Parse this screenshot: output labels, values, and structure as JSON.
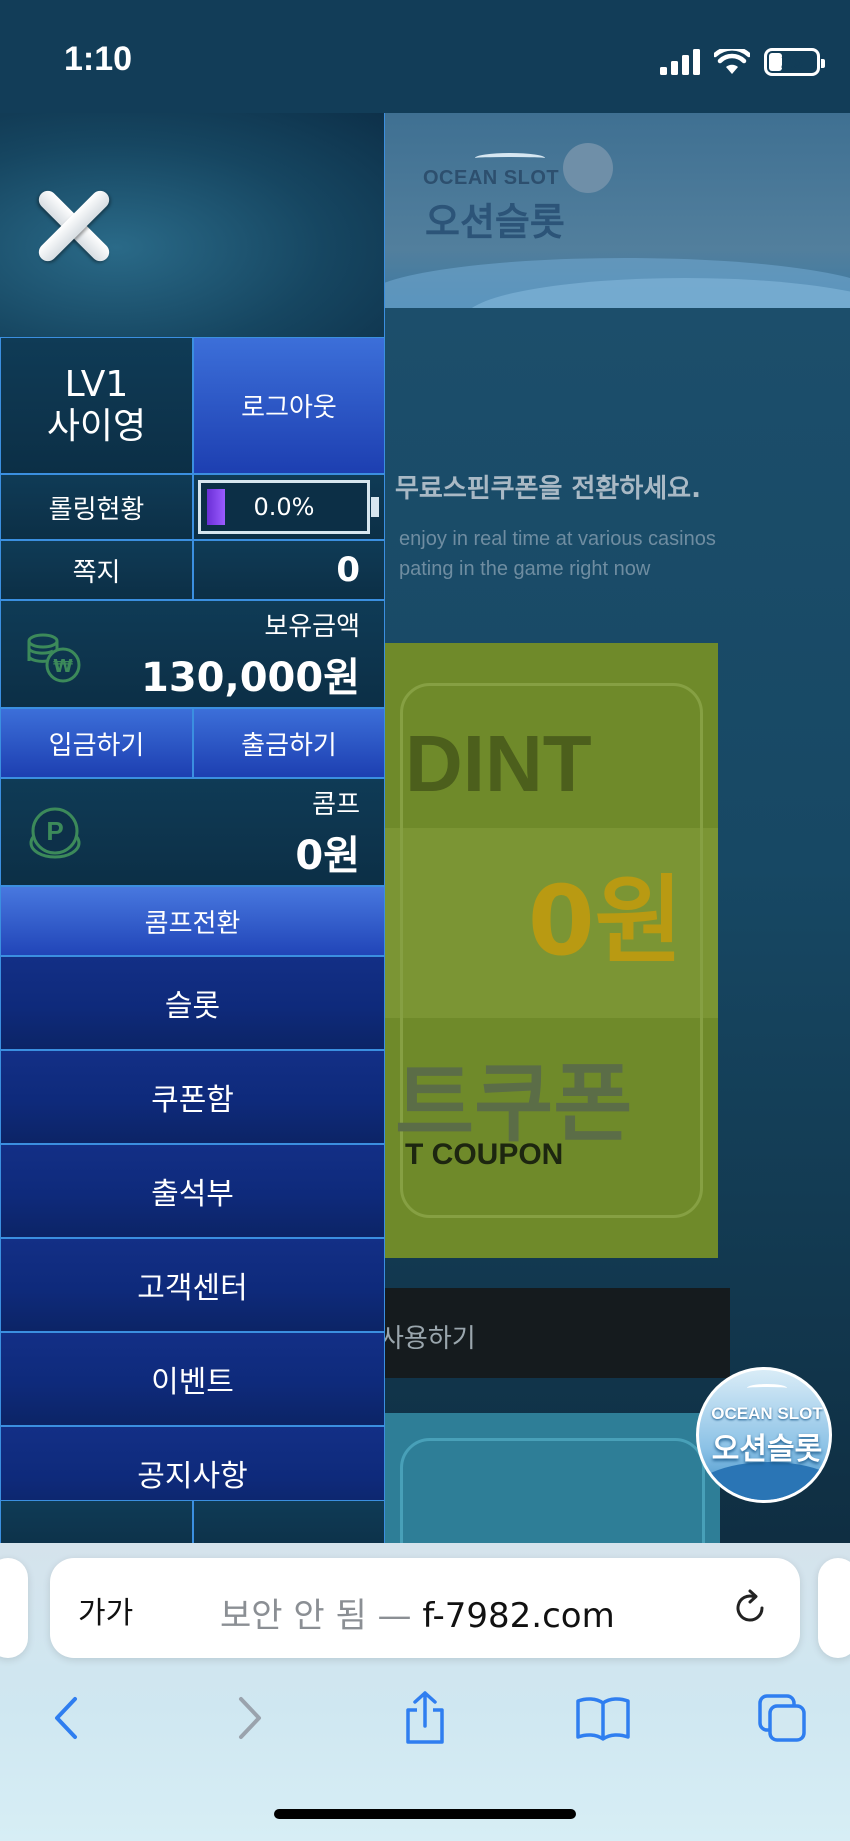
{
  "status_bar": {
    "time": "1:10",
    "battery": "26"
  },
  "background": {
    "logo_en": "OCEAN SLOT",
    "logo_ko": "오션슬롯",
    "headline": "무료스핀쿠폰을 전환하세요.",
    "subtext_1": "enjoy in real time at various casinos",
    "subtext_2": "pating in the game right now",
    "coupon_word": "DINT",
    "coupon_amount": "0원",
    "coupon_ko": "트쿠폰",
    "coupon_en": "T COUPON",
    "use_button": "사용하기"
  },
  "float_badge": {
    "en": "OCEAN SLOT",
    "ko": "오션슬롯"
  },
  "drawer": {
    "user": {
      "level": "LV1",
      "name": "사이영"
    },
    "logout": "로그아웃",
    "rolling": {
      "label": "롤링현황",
      "value": "0.0%",
      "progress": 0.0
    },
    "note": {
      "label": "쪽지",
      "count": "0"
    },
    "balance": {
      "label": "보유금액",
      "amount": "130,000원"
    },
    "deposit": "입금하기",
    "withdraw": "출금하기",
    "comp": {
      "label": "콤프",
      "amount": "0원"
    },
    "comp_convert": "콤프전환",
    "menu": [
      "슬롯",
      "쿠폰함",
      "출석부",
      "고객센터",
      "이벤트",
      "공지사항"
    ]
  },
  "safari": {
    "reader": "가가",
    "url_prefix": "보안 안 됨 — ",
    "url_host": "f-7982.com"
  },
  "colors": {
    "drawer_border": "#3b8fe0",
    "button_blue": "#2a4fc4",
    "menu_navy": "#10297f",
    "icon_green": "#3c8a5a"
  }
}
